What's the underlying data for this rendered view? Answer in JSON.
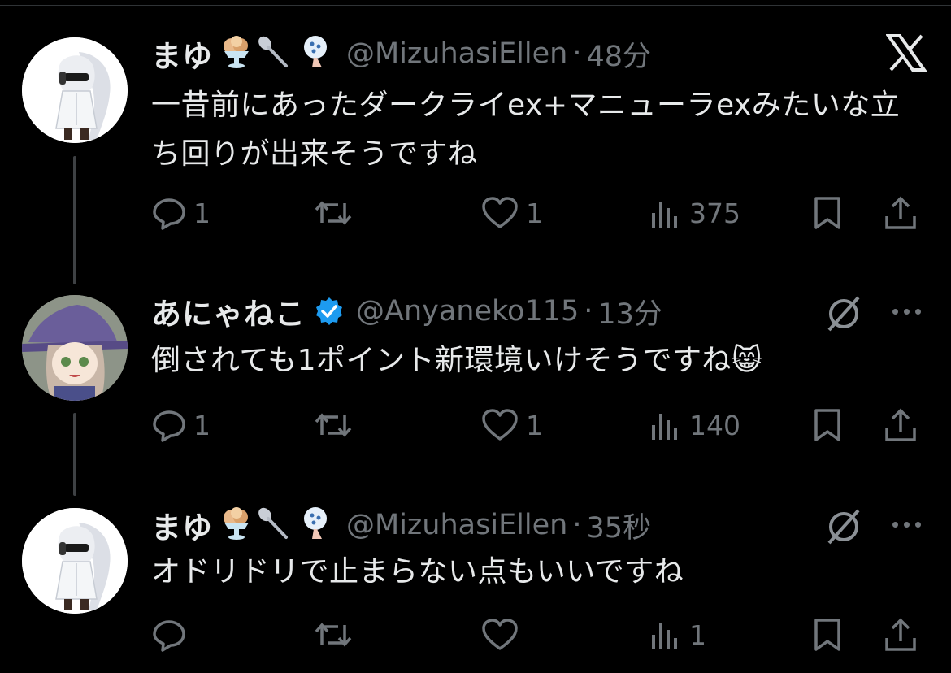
{
  "colors": {
    "background": "#000000",
    "text_primary": "#e7e9ea",
    "text_secondary": "#71767b",
    "verified": "#1d9bf0"
  },
  "tweets": [
    {
      "name": "まゆ",
      "emoji_icons": [
        "ice-cream-icon",
        "spoon-icon",
        "fan-icon"
      ],
      "handle": "@MizuhasiEllen",
      "separator": "·",
      "time": "48分",
      "text": "一昔前にあったダークライex+マニューラexみたいな立ち回りが出来そうですね",
      "replies": "1",
      "retweets": "",
      "likes": "1",
      "views": "375",
      "corner_icon": "x-logo-icon"
    },
    {
      "name": "あにゃねこ",
      "verified": true,
      "handle": "@Anyaneko115",
      "separator": "·",
      "time": "13分",
      "text": "倒されても1ポイント新環境いけそうですね😸",
      "replies": "1",
      "retweets": "",
      "likes": "1",
      "views": "140",
      "corner_icon": "grok-icon"
    },
    {
      "name": "まゆ",
      "emoji_icons": [
        "ice-cream-icon",
        "spoon-icon",
        "fan-icon"
      ],
      "handle": "@MizuhasiEllen",
      "separator": "·",
      "time": "35秒",
      "text": "オドリドリで止まらない点もいいですね",
      "replies": "",
      "retweets": "",
      "likes": "",
      "views": "1",
      "corner_icon": "grok-icon"
    }
  ]
}
